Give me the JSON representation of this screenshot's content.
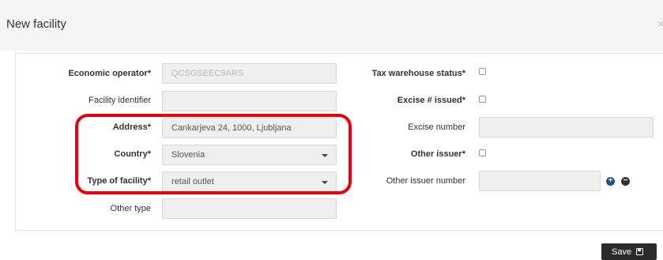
{
  "dialog": {
    "title": "New facility",
    "close_glyph": "×"
  },
  "form": {
    "economic_operator": {
      "label": "Economic operator*",
      "value": "QCSGSEEC9ARS"
    },
    "facility_identifier": {
      "label": "Facility identifier",
      "value": ""
    },
    "address": {
      "label": "Address*",
      "value": "Cankarjeva 24, 1000, Ljubljana"
    },
    "country": {
      "label": "Country*",
      "value": "Slovenia"
    },
    "type_of_facility": {
      "label": "Type of facility*",
      "value": "retail outlet"
    },
    "other_type": {
      "label": "Other type",
      "value": ""
    },
    "tax_warehouse_status": {
      "label": "Tax warehouse status*",
      "checked": false
    },
    "excise_issued": {
      "label": "Excise # issued*",
      "checked": false
    },
    "excise_number": {
      "label": "Excise number",
      "value": ""
    },
    "other_issuer": {
      "label": "Other issuer*",
      "checked": false
    },
    "other_issuer_number": {
      "label": "Other issuer number",
      "value": ""
    }
  },
  "actions": {
    "add_glyph": "+",
    "remove_glyph": "−",
    "save_label": "Save"
  },
  "annotation": {
    "highlight_color": "#e8000b"
  },
  "icons": [
    "close-icon",
    "chevron-down-icon",
    "plus-circle-icon",
    "minus-circle-icon",
    "floppy-disk-icon"
  ]
}
